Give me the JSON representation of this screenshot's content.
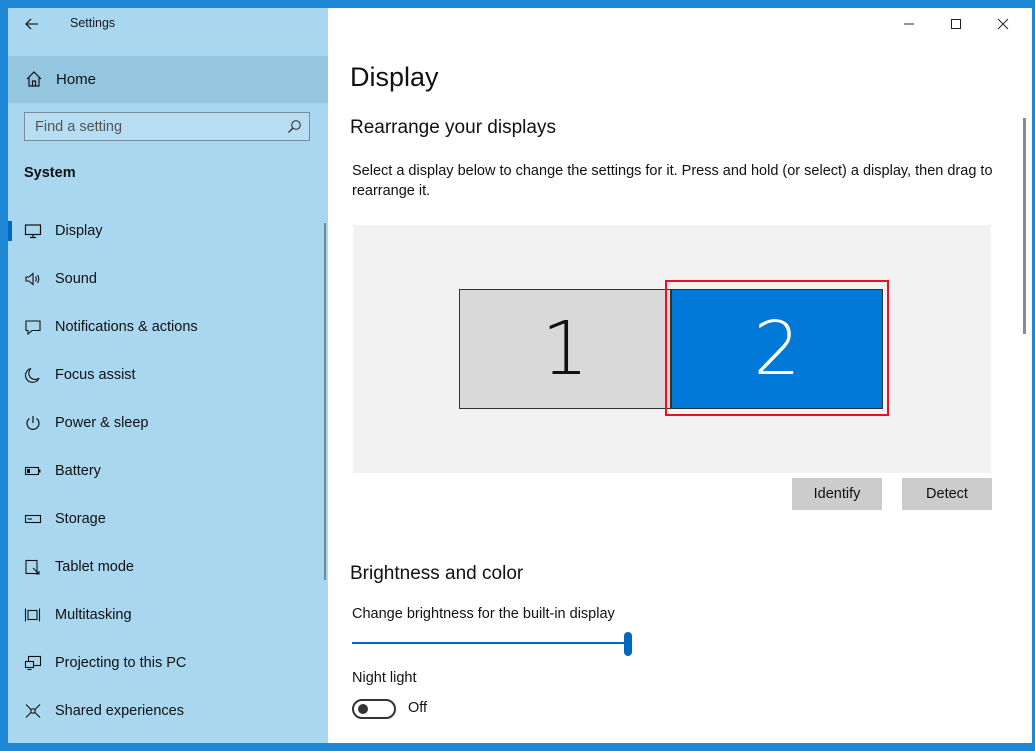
{
  "window": {
    "title": "Settings"
  },
  "sidebar": {
    "home_label": "Home",
    "search_placeholder": "Find a setting",
    "section": "System",
    "items": [
      {
        "label": "Display",
        "icon": "monitor-icon",
        "selected": true
      },
      {
        "label": "Sound",
        "icon": "speaker-icon"
      },
      {
        "label": "Notifications & actions",
        "icon": "notification-icon"
      },
      {
        "label": "Focus assist",
        "icon": "moon-icon"
      },
      {
        "label": "Power & sleep",
        "icon": "power-icon"
      },
      {
        "label": "Battery",
        "icon": "battery-icon"
      },
      {
        "label": "Storage",
        "icon": "storage-icon"
      },
      {
        "label": "Tablet mode",
        "icon": "tablet-mode-icon"
      },
      {
        "label": "Multitasking",
        "icon": "multitasking-icon"
      },
      {
        "label": "Projecting to this PC",
        "icon": "projecting-icon"
      },
      {
        "label": "Shared experiences",
        "icon": "shared-experiences-icon"
      }
    ]
  },
  "main": {
    "title": "Display",
    "rearrange": {
      "heading": "Rearrange your displays",
      "description": "Select a display below to change the settings for it. Press and hold (or select) a display, then drag to rearrange it.",
      "monitors": [
        {
          "label": "1",
          "selected": false
        },
        {
          "label": "2",
          "selected": true
        }
      ],
      "identify_label": "Identify",
      "detect_label": "Detect"
    },
    "brightness": {
      "heading": "Brightness and color",
      "slider_label": "Change brightness for the built-in display",
      "level_percent": 100,
      "night_light_label": "Night light",
      "night_light_state": "Off"
    }
  },
  "colors": {
    "sidebar_bg": "#a9d7ef",
    "accent": "#0078d7",
    "highlight": "#e81123"
  }
}
